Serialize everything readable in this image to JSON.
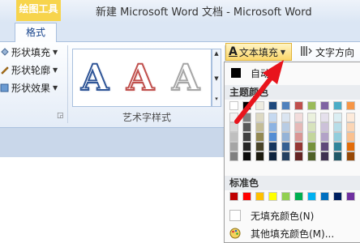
{
  "titlebar": {
    "context_tab": "绘图工具",
    "title": "新建 Microsoft Word 文档 - Microsoft Word"
  },
  "ribbon_tabs": {
    "format": "格式"
  },
  "shape_styles": {
    "fill": "形状填充",
    "outline": "形状轮廓",
    "effects": "形状效果"
  },
  "wordart": {
    "group_label": "艺术字样式",
    "samples": [
      {
        "glyph": "A",
        "outline_color": "#2f5597"
      },
      {
        "glyph": "A",
        "outline_color": "#c0504d"
      },
      {
        "glyph": "A",
        "outline_color": "#a6a6a6"
      }
    ]
  },
  "text_fill_button": {
    "label": "文本填充",
    "icon": "text-fill-icon"
  },
  "text_direction_button": {
    "label": "文字方向",
    "icon": "text-direction-icon"
  },
  "dropdown": {
    "auto_label": "自动",
    "theme_colors_heading": "主题颜色",
    "standard_colors_heading": "标准色",
    "no_fill_label": "无填充颜色(N)",
    "more_colors_label": "其他填充颜色(M)...",
    "more_colors_icon": "palette-icon",
    "theme_colors": [
      [
        "#ffffff",
        "#000000",
        "#eeece1",
        "#1f497d",
        "#4f81bd",
        "#c0504d",
        "#9bbb59",
        "#8064a2",
        "#4bacc6",
        "#f79646"
      ],
      [
        "#f2f2f2",
        "#7f7f7f",
        "#ddd9c3",
        "#c6d9f0",
        "#dbe5f1",
        "#f2dcdb",
        "#ebf1dd",
        "#e5e0ec",
        "#dbeef3",
        "#fdeada"
      ],
      [
        "#d8d8d8",
        "#595959",
        "#c4bd97",
        "#8db3e2",
        "#b8cce4",
        "#e5b9b7",
        "#d7e3bc",
        "#ccc1d9",
        "#b7dde8",
        "#fbd5b5"
      ],
      [
        "#bfbfbf",
        "#3f3f3f",
        "#938953",
        "#548dd4",
        "#95b3d7",
        "#d99694",
        "#c3d69b",
        "#b2a2c7",
        "#92cddc",
        "#fac08f"
      ],
      [
        "#a5a5a5",
        "#262626",
        "#494429",
        "#17365d",
        "#366092",
        "#953734",
        "#76923c",
        "#5f497a",
        "#31859b",
        "#e36c09"
      ],
      [
        "#7f7f7f",
        "#0c0c0c",
        "#1d1b10",
        "#0f243e",
        "#244061",
        "#632423",
        "#4f6128",
        "#3f3151",
        "#205867",
        "#974806"
      ]
    ],
    "standard_colors": [
      "#c00000",
      "#ff0000",
      "#ffc000",
      "#ffff00",
      "#92d050",
      "#00b050",
      "#00b0f0",
      "#0070c0",
      "#002060",
      "#7030a0"
    ]
  },
  "annotation": {
    "arrow_color": "#e8141c"
  }
}
